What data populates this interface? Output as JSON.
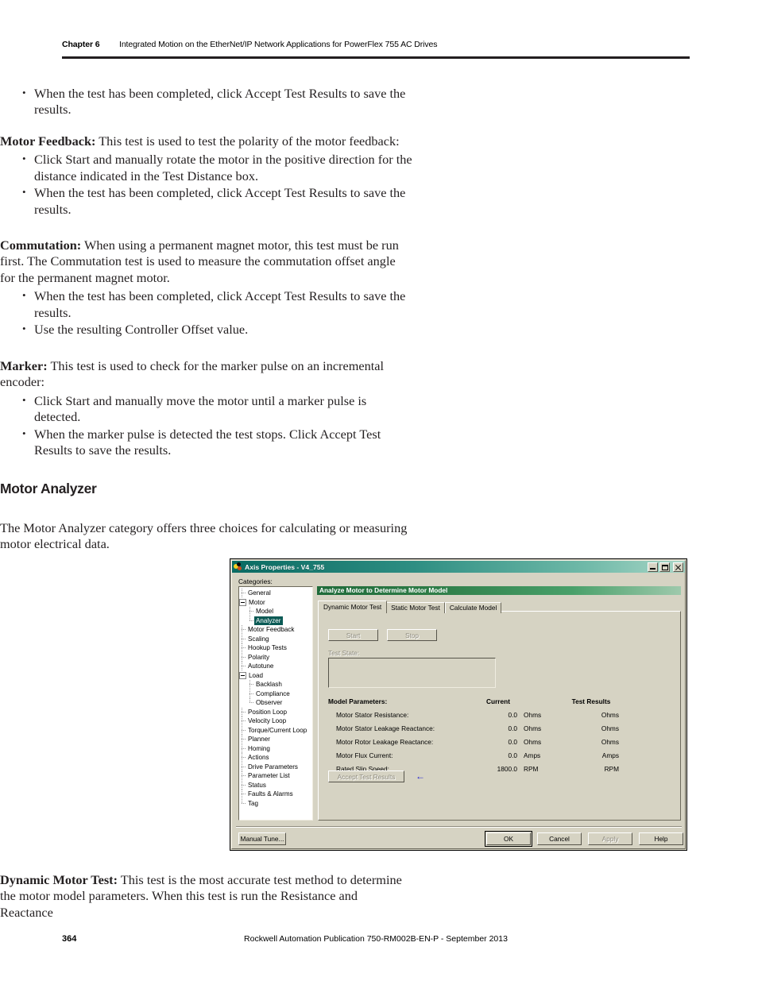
{
  "header": {
    "chapter": "Chapter 6",
    "title": "Integrated Motion on the EtherNet/IP Network Applications for PowerFlex 755 AC Drives"
  },
  "body": {
    "bullet_1": "When the test has been completed, click Accept Test Results to save the results.",
    "motor_feedback_lead": "Motor Feedback:",
    "motor_feedback_text": " This test is used to test the polarity of the motor feedback:",
    "mf_bullet_1": "Click Start and manually rotate the motor in the positive direction for the distance indicated in the Test Distance box.",
    "mf_bullet_2": "When the test has been completed, click Accept Test Results to save the results.",
    "commutation_lead": "Commutation:",
    "commutation_text": " When using a permanent magnet motor, this test must be run first. The Commutation test is used to measure the commutation offset angle for the permanent magnet motor.",
    "cm_bullet_1": "When the test has been completed, click Accept Test Results to save the results.",
    "cm_bullet_2": "Use the resulting Controller Offset value.",
    "marker_lead": "Marker:",
    "marker_text": " This test is used to check for the marker pulse on an incremental encoder:",
    "mk_bullet_1": "Click Start and manually move the motor until a marker pulse is detected.",
    "mk_bullet_2": "When the marker pulse is detected the test stops. Click Accept Test Results to save the results.",
    "section_heading": "Motor Analyzer",
    "section_paragraph": "The Motor Analyzer category offers three choices for calculating or measuring motor electrical data.",
    "dynamic_lead": "Dynamic Motor Test:",
    "dynamic_text": " This test is the most accurate test method to determine the motor model parameters. When this test is run the Resistance and Reactance"
  },
  "dialog": {
    "title": "Axis Properties - V4_755",
    "titlebar_icon": "axis-properties-icon",
    "window_buttons": {
      "minimize": "minimize-icon",
      "maximize": "maximize-icon",
      "close": "close-icon"
    },
    "categories_label": "Categories:",
    "tree": [
      {
        "label": "General",
        "depth": 0,
        "expander": false,
        "selected": false,
        "last": false
      },
      {
        "label": "Motor",
        "depth": 0,
        "expander": true,
        "selected": false,
        "last": false
      },
      {
        "label": "Model",
        "depth": 1,
        "expander": false,
        "selected": false,
        "last": false
      },
      {
        "label": "Analyzer",
        "depth": 1,
        "expander": false,
        "selected": true,
        "last": true
      },
      {
        "label": "Motor Feedback",
        "depth": 0,
        "expander": false,
        "selected": false,
        "last": false
      },
      {
        "label": "Scaling",
        "depth": 0,
        "expander": false,
        "selected": false,
        "last": false
      },
      {
        "label": "Hookup Tests",
        "depth": 0,
        "expander": false,
        "selected": false,
        "last": false
      },
      {
        "label": "Polarity",
        "depth": 0,
        "expander": false,
        "selected": false,
        "last": false
      },
      {
        "label": "Autotune",
        "depth": 0,
        "expander": false,
        "selected": false,
        "last": false
      },
      {
        "label": "Load",
        "depth": 0,
        "expander": true,
        "selected": false,
        "last": false
      },
      {
        "label": "Backlash",
        "depth": 1,
        "expander": false,
        "selected": false,
        "last": false
      },
      {
        "label": "Compliance",
        "depth": 1,
        "expander": false,
        "selected": false,
        "last": false
      },
      {
        "label": "Observer",
        "depth": 1,
        "expander": false,
        "selected": false,
        "last": true
      },
      {
        "label": "Position Loop",
        "depth": 0,
        "expander": false,
        "selected": false,
        "last": false
      },
      {
        "label": "Velocity Loop",
        "depth": 0,
        "expander": false,
        "selected": false,
        "last": false
      },
      {
        "label": "Torque/Current Loop",
        "depth": 0,
        "expander": false,
        "selected": false,
        "last": false
      },
      {
        "label": "Planner",
        "depth": 0,
        "expander": false,
        "selected": false,
        "last": false
      },
      {
        "label": "Homing",
        "depth": 0,
        "expander": false,
        "selected": false,
        "last": false
      },
      {
        "label": "Actions",
        "depth": 0,
        "expander": false,
        "selected": false,
        "last": false
      },
      {
        "label": "Drive Parameters",
        "depth": 0,
        "expander": false,
        "selected": false,
        "last": false
      },
      {
        "label": "Parameter List",
        "depth": 0,
        "expander": false,
        "selected": false,
        "last": false
      },
      {
        "label": "Status",
        "depth": 0,
        "expander": false,
        "selected": false,
        "last": false
      },
      {
        "label": "Faults & Alarms",
        "depth": 0,
        "expander": false,
        "selected": false,
        "last": false
      },
      {
        "label": "Tag",
        "depth": 0,
        "expander": false,
        "selected": false,
        "last": true
      }
    ],
    "group_header": "Analyze Motor to Determine Motor Model",
    "tabs": [
      {
        "label": "Dynamic Motor Test",
        "active": true
      },
      {
        "label": "Static Motor Test",
        "active": false
      },
      {
        "label": "Calculate Model",
        "active": false
      }
    ],
    "start_button": "Start",
    "stop_button": "Stop",
    "test_state_label": "Test State:",
    "test_state_value": "",
    "table": {
      "headers": [
        "Model Parameters:",
        "Current",
        "",
        "Test Results"
      ],
      "rows": [
        {
          "name": "Motor Stator Resistance:",
          "current": "0.0",
          "unit": "Ohms",
          "result_unit": "Ohms"
        },
        {
          "name": "Motor Stator Leakage Reactance:",
          "current": "0.0",
          "unit": "Ohms",
          "result_unit": "Ohms"
        },
        {
          "name": "Motor Rotor Leakage Reactance:",
          "current": "0.0",
          "unit": "Ohms",
          "result_unit": "Ohms"
        },
        {
          "name": "Motor Flux Current:",
          "current": "0.0",
          "unit": "Amps",
          "result_unit": "Amps"
        },
        {
          "name": "Rated Slip Speed:",
          "current": "1800.0",
          "unit": "RPM",
          "result_unit": "RPM"
        }
      ]
    },
    "accept_button": "Accept Test Results",
    "annotation_arrow": "left-arrow-annotation",
    "annotation_arrow_glyph": "←",
    "manual_tune_button": "Manual Tune...",
    "ok_button": "OK",
    "cancel_button": "Cancel",
    "apply_button": "Apply",
    "help_button": "Help",
    "colors": {
      "titlebar": "#2e8e82",
      "group_header": "#2d7b46",
      "selection": "#0a5a55",
      "face": "#d6d3c3",
      "annotation": "#2020d0"
    }
  },
  "footer": {
    "page_number": "364",
    "publication": "Rockwell Automation Publication 750-RM002B-EN-P - September 2013"
  }
}
